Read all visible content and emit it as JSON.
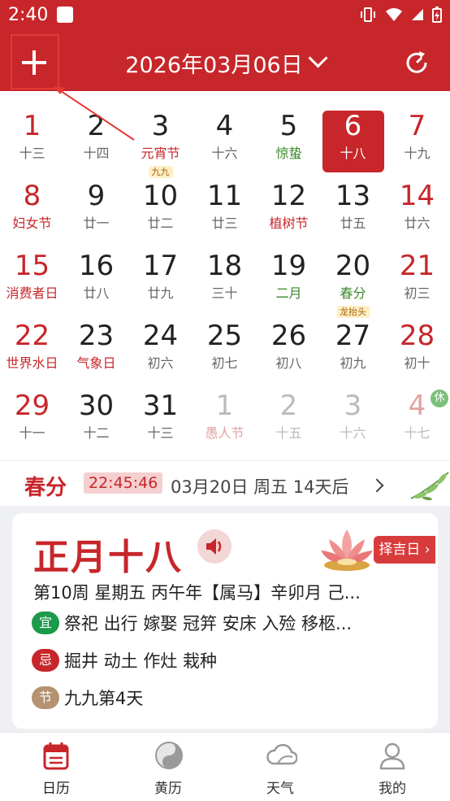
{
  "status": {
    "time": "2:40"
  },
  "header": {
    "title": "2026年03月06日"
  },
  "colors": {
    "accent": "#c7262a",
    "term_green": "#3a8a2a"
  },
  "calendar": {
    "weeks": [
      [
        {
          "day": "1",
          "sub": "十三",
          "weekend": true
        },
        {
          "day": "2",
          "sub": "十四"
        },
        {
          "day": "3",
          "sub": "元宵节",
          "festival": true,
          "badge": "九九"
        },
        {
          "day": "4",
          "sub": "十六"
        },
        {
          "day": "5",
          "sub": "惊蛰",
          "term": true
        },
        {
          "day": "6",
          "sub": "十八",
          "selected": true
        },
        {
          "day": "7",
          "sub": "十九",
          "weekend": true
        }
      ],
      [
        {
          "day": "8",
          "sub": "妇女节",
          "weekend": true,
          "festival": true
        },
        {
          "day": "9",
          "sub": "廿一"
        },
        {
          "day": "10",
          "sub": "廿二"
        },
        {
          "day": "11",
          "sub": "廿三"
        },
        {
          "day": "12",
          "sub": "植树节",
          "festival": true
        },
        {
          "day": "13",
          "sub": "廿五"
        },
        {
          "day": "14",
          "sub": "廿六",
          "weekend": true
        }
      ],
      [
        {
          "day": "15",
          "sub": "消费者日",
          "weekend": true,
          "festival": true
        },
        {
          "day": "16",
          "sub": "廿八"
        },
        {
          "day": "17",
          "sub": "廿九"
        },
        {
          "day": "18",
          "sub": "三十"
        },
        {
          "day": "19",
          "sub": "二月",
          "term": true
        },
        {
          "day": "20",
          "sub": "春分",
          "term": true,
          "badge": "龙抬头"
        },
        {
          "day": "21",
          "sub": "初三",
          "weekend": true
        }
      ],
      [
        {
          "day": "22",
          "sub": "世界水日",
          "weekend": true,
          "festival": true
        },
        {
          "day": "23",
          "sub": "气象日",
          "festival": true
        },
        {
          "day": "24",
          "sub": "初六"
        },
        {
          "day": "25",
          "sub": "初七"
        },
        {
          "day": "26",
          "sub": "初八"
        },
        {
          "day": "27",
          "sub": "初九"
        },
        {
          "day": "28",
          "sub": "初十",
          "weekend": true
        }
      ],
      [
        {
          "day": "29",
          "sub": "十一",
          "weekend": true
        },
        {
          "day": "30",
          "sub": "十二"
        },
        {
          "day": "31",
          "sub": "十三"
        },
        {
          "day": "1",
          "sub": "愚人节",
          "faded": true,
          "festival": true
        },
        {
          "day": "2",
          "sub": "十五",
          "faded": true
        },
        {
          "day": "3",
          "sub": "十六",
          "faded": true
        },
        {
          "day": "4",
          "sub": "十七",
          "faded": true,
          "weekend": true
        }
      ]
    ],
    "rest_badge": "休"
  },
  "solar_term": {
    "name": "春分",
    "countdown": "22:45:46",
    "date_text": "03月20日  周五  14天后"
  },
  "almanac": {
    "lunar_date": "正月十八",
    "zeji_label": "择吉日",
    "info_line": "第10周 星期五 丙午年【属马】辛卯月 己...",
    "yi_label": "宜",
    "yi_text": "祭祀 出行 嫁娶 冠笄 安床 入殓 移柩...",
    "ji_label": "忌",
    "ji_text": "掘井 动土 作灶 栽种",
    "jie_label": "节",
    "jie_text": "九九第4天"
  },
  "tabs": [
    {
      "label": "日历",
      "icon": "calendar-icon"
    },
    {
      "label": "黄历",
      "icon": "yinyang-icon"
    },
    {
      "label": "天气",
      "icon": "weather-icon"
    },
    {
      "label": "我的",
      "icon": "profile-icon"
    }
  ]
}
